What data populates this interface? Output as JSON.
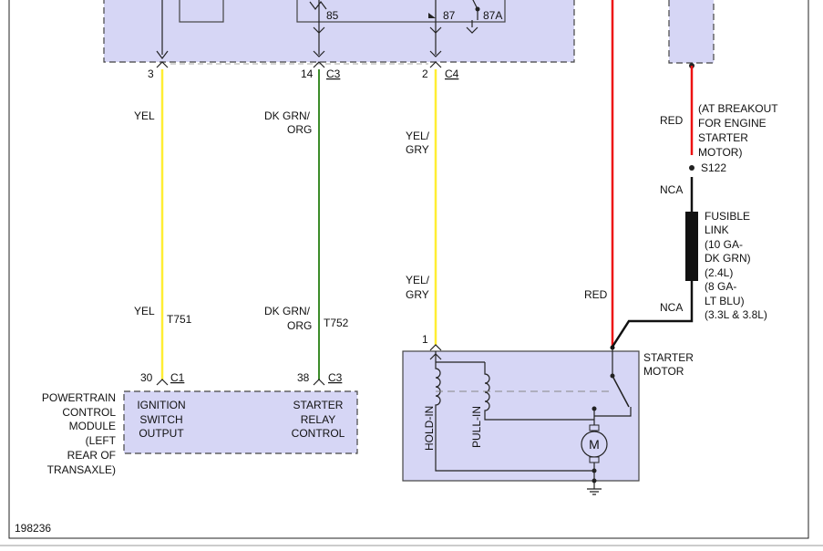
{
  "colors": {
    "module_fill": "#d6d6f5",
    "wire_yellow": "#ffee33",
    "wire_green": "#3c8c2a",
    "wire_red": "#ee1111",
    "wire_black": "#111111",
    "border": "#444444"
  },
  "connectors": {
    "c3_top_pin": "3",
    "c14_pin": "14",
    "c14_name": "C3",
    "c4_pin": "2",
    "c4_name": "C4",
    "relay_85": "85",
    "relay_87": "87",
    "relay_87a": "87A",
    "pcm_c1_pin": "30",
    "pcm_c1_name": "C1",
    "pcm_c3_pin": "38",
    "pcm_c3_name": "C3",
    "starter_pin": "1"
  },
  "wires": {
    "yel_top": "YEL",
    "yel_bottom": "YEL",
    "yel_circuit": "T751",
    "dkgrn_top_l1": "DK GRN/",
    "dkgrn_top_l2": "ORG",
    "dkgrn_bot_l1": "DK GRN/",
    "dkgrn_bot_l2": "ORG",
    "dkgrn_circuit": "T752",
    "yelgry_top_l1": "YEL/",
    "yelgry_top_l2": "GRY",
    "yelgry_bot_l1": "YEL/",
    "yelgry_bot_l2": "GRY",
    "red_left": "RED",
    "red_right": "RED",
    "nca_top": "NCA",
    "nca_bottom": "NCA"
  },
  "breakout_note": [
    "(AT BREAKOUT",
    "FOR ENGINE",
    "STARTER",
    "MOTOR)"
  ],
  "splice": "S122",
  "fusible_link": [
    "FUSIBLE",
    "LINK",
    "(10 GA-",
    "DK GRN)",
    "(2.4L)",
    "(8 GA-",
    "LT BLU)",
    "(3.3L & 3.8L)"
  ],
  "pcm": {
    "name_lines": [
      "POWERTRAIN",
      "CONTROL",
      "MODULE",
      "(LEFT",
      "REAR OF",
      "TRANSAXLE)"
    ],
    "ignition_lines": [
      "IGNITION",
      "SWITCH",
      "OUTPUT"
    ],
    "relay_lines": [
      "STARTER",
      "RELAY",
      "CONTROL"
    ]
  },
  "starter": {
    "name_lines": [
      "STARTER",
      "MOTOR"
    ],
    "hold_in": "HOLD-IN",
    "pull_in": "PULL-IN",
    "motor_symbol": "M"
  },
  "figure_id": "198236"
}
